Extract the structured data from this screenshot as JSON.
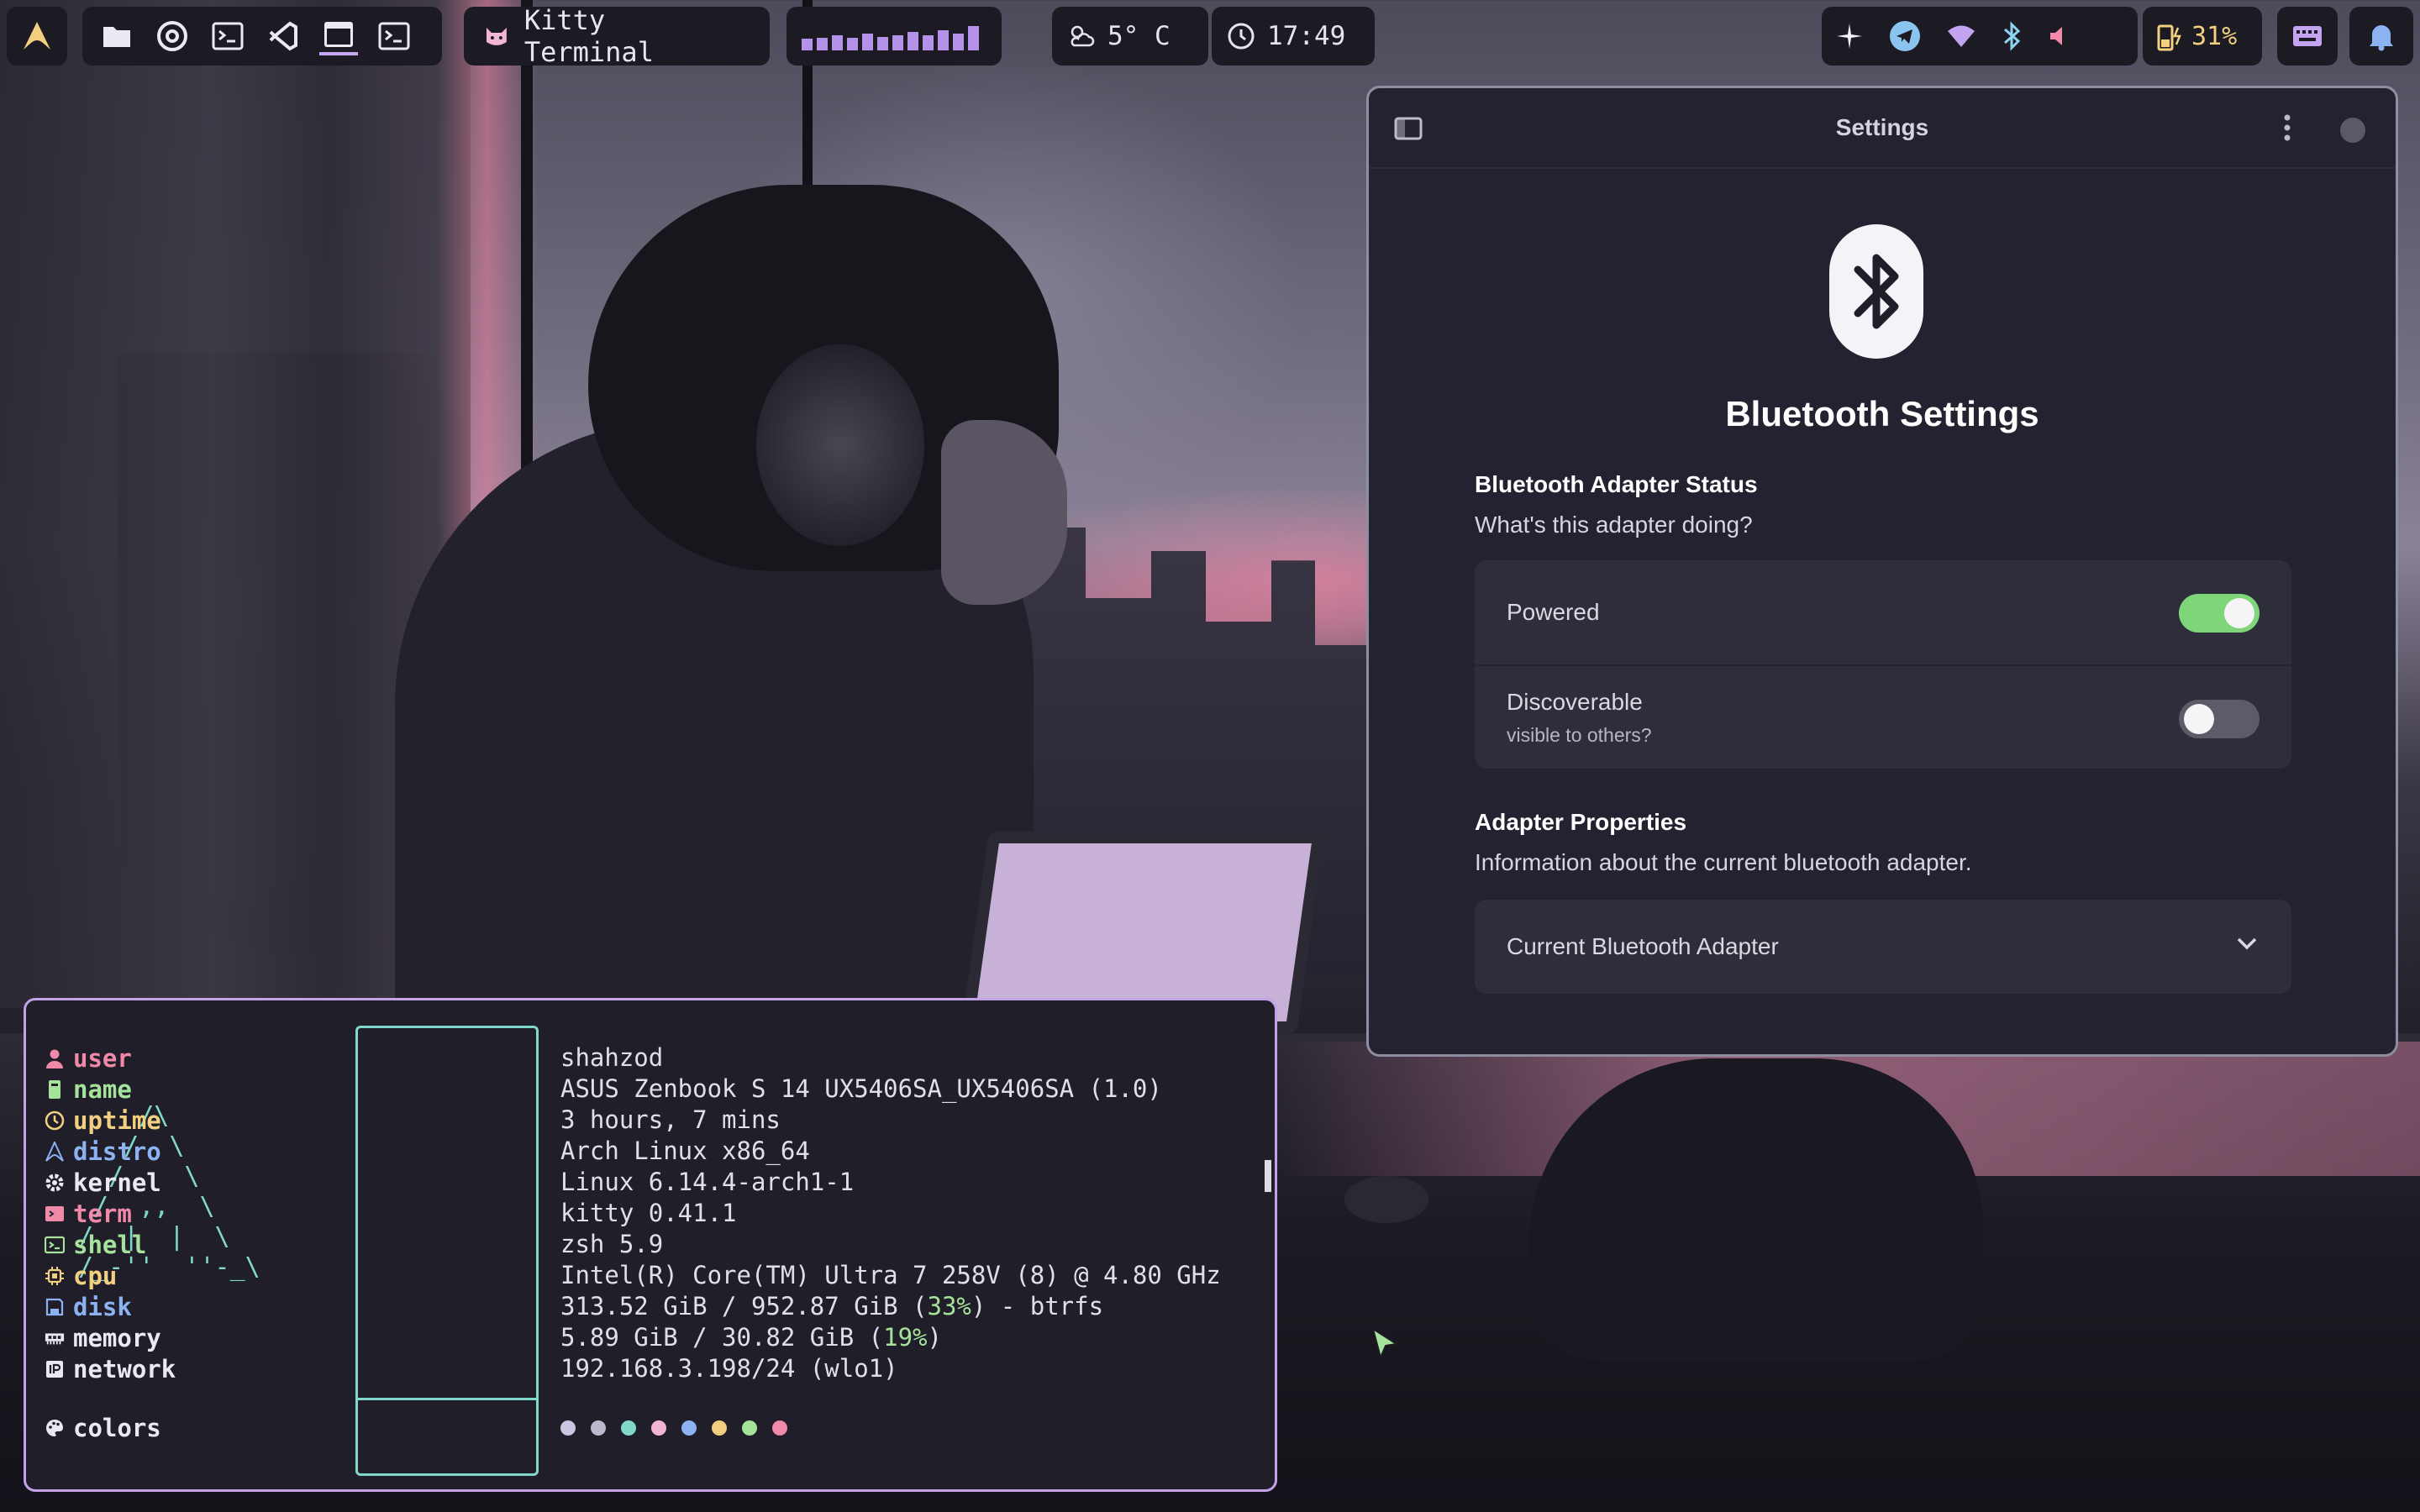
{
  "topbar": {
    "window_title": "Kitty Terminal",
    "weather": "5° C",
    "clock": "17:49",
    "battery": "31%",
    "visualizer_levels": [
      0.3,
      0.35,
      0.45,
      0.35,
      0.55,
      0.4,
      0.45,
      0.6,
      0.45,
      0.7,
      0.55,
      0.9
    ],
    "apps": [
      "files-icon",
      "chrome-icon",
      "terminal-icon",
      "vscode-icon",
      "window-icon",
      "terminal-icon"
    ],
    "accent": "#c7a8f2"
  },
  "settings": {
    "window_title": "Settings",
    "heading": "Bluetooth Settings",
    "status_section": {
      "title": "Bluetooth Adapter Status",
      "description": "What's this adapter doing?",
      "powered_label": "Powered",
      "powered_on": true,
      "discoverable_label": "Discoverable",
      "discoverable_sub": "visible to others?",
      "discoverable_on": false
    },
    "properties_section": {
      "title": "Adapter Properties",
      "description": "Information about the current bluetooth adapter.",
      "dropdown_label": "Current Bluetooth Adapter"
    },
    "toggle_on_color": "#7fd67a"
  },
  "terminal": {
    "ascii_logo": "    /\\\n   /  \\\n  /    \\\n /  ,,  \\\n/  |  |  \\\n/_-''  ''-_\\",
    "keys": [
      {
        "label": "user",
        "color": "#f08aa8",
        "icon": "user-icon"
      },
      {
        "label": "name",
        "color": "#a6e39a",
        "icon": "device-icon"
      },
      {
        "label": "uptime",
        "color": "#f2d07f",
        "icon": "clock-icon"
      },
      {
        "label": "distro",
        "color": "#8cb2f2",
        "icon": "arch-icon"
      },
      {
        "label": "kernel",
        "color": "#ebe8f2",
        "icon": "gear-icon"
      },
      {
        "label": "term",
        "color": "#f08aa8",
        "icon": "term-icon"
      },
      {
        "label": "shell",
        "color": "#a6e39a",
        "icon": "shell-icon"
      },
      {
        "label": "cpu",
        "color": "#f2d07f",
        "icon": "cpu-icon"
      },
      {
        "label": "disk",
        "color": "#8cb2f2",
        "icon": "disk-icon"
      },
      {
        "label": "memory",
        "color": "#ebe8f2",
        "icon": "memory-icon"
      },
      {
        "label": "network",
        "color": "#ebe8f2",
        "icon": "network-icon"
      }
    ],
    "values": {
      "user": "shahzod",
      "name": "ASUS Zenbook S 14 UX5406SA_UX5406SA (1.0)",
      "uptime": "3 hours, 7 mins",
      "distro": "Arch Linux x86_64",
      "kernel": "Linux 6.14.4-arch1-1",
      "term": "kitty 0.41.1",
      "shell": "zsh 5.9",
      "cpu": "Intel(R) Core(TM) Ultra 7 258V (8) @ 4.80 GHz",
      "disk_prefix": "313.52 GiB / 952.87 GiB (",
      "disk_pct": "33%",
      "disk_suffix": ") - btrfs",
      "memory_prefix": "5.89 GiB / 30.82 GiB (",
      "memory_pct": "19%",
      "memory_suffix": ")",
      "network": "192.168.3.198/24 (wlo1)"
    },
    "colors_label": "colors",
    "palette": [
      "#c9c6e4",
      "#b9b8cc",
      "#7fd8c9",
      "#f3b6d2",
      "#8cb2f2",
      "#f2d07f",
      "#a6e39a",
      "#f08aa8"
    ],
    "border_color": "#c2a3e8"
  }
}
